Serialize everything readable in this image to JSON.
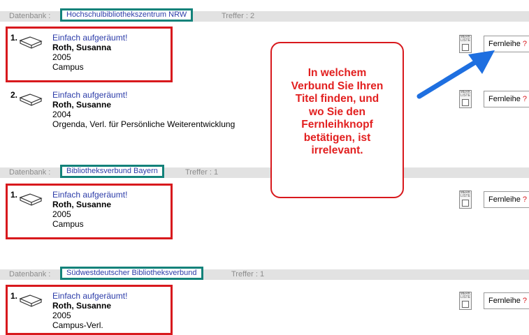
{
  "groups": [
    {
      "db_label": "Datenbank :",
      "db_name": "Hochschulbibliothekszentrum NRW",
      "hits": "Treffer :  2",
      "records": [
        {
          "num": "1.",
          "title": "Einfach aufgeräumt!",
          "author": "Roth, Susanna",
          "year": "2005",
          "publisher": "Campus"
        },
        {
          "num": "2.",
          "title": "Einfach aufgeräumt!",
          "author": "Roth, Susanne",
          "year": "2004",
          "publisher": "Orgenda, Verl. für Persönliche Weiterentwicklung"
        }
      ]
    },
    {
      "db_label": "Datenbank :",
      "db_name": "Bibliotheksverbund Bayern",
      "hits": "Treffer :  1",
      "records": [
        {
          "num": "1.",
          "title": "Einfach aufgeräumt!",
          "author": "Roth, Susanne",
          "year": "2005",
          "publisher": "Campus"
        }
      ]
    },
    {
      "db_label": "Datenbank :",
      "db_name": "Südwestdeutscher Bibliotheksverbund",
      "hits": "Treffer :  1",
      "records": [
        {
          "num": "1.",
          "title": "Einfach aufgeräumt!",
          "author": "Roth, Susanne",
          "year": "2005",
          "publisher": "Campus-Verl."
        }
      ]
    }
  ],
  "merkliste_label": "MERK LISTE",
  "fernleihe_label": "Fernleihe",
  "fernleihe_help": "?",
  "callout": {
    "lines": [
      "In welchem",
      "Verbund Sie Ihren",
      "Titel finden, und",
      "wo Sie den",
      "Fernleihknopf",
      "betätigen, ist",
      "irrelevant."
    ]
  },
  "colors": {
    "highlight": "#d8191d",
    "db_border": "#13827a",
    "link": "#2b3ba8",
    "arrow": "#1e6fe0"
  },
  "icons": {
    "record": "book-icon",
    "merkliste": "merkliste-icon",
    "arrow": "arrow-icon"
  }
}
